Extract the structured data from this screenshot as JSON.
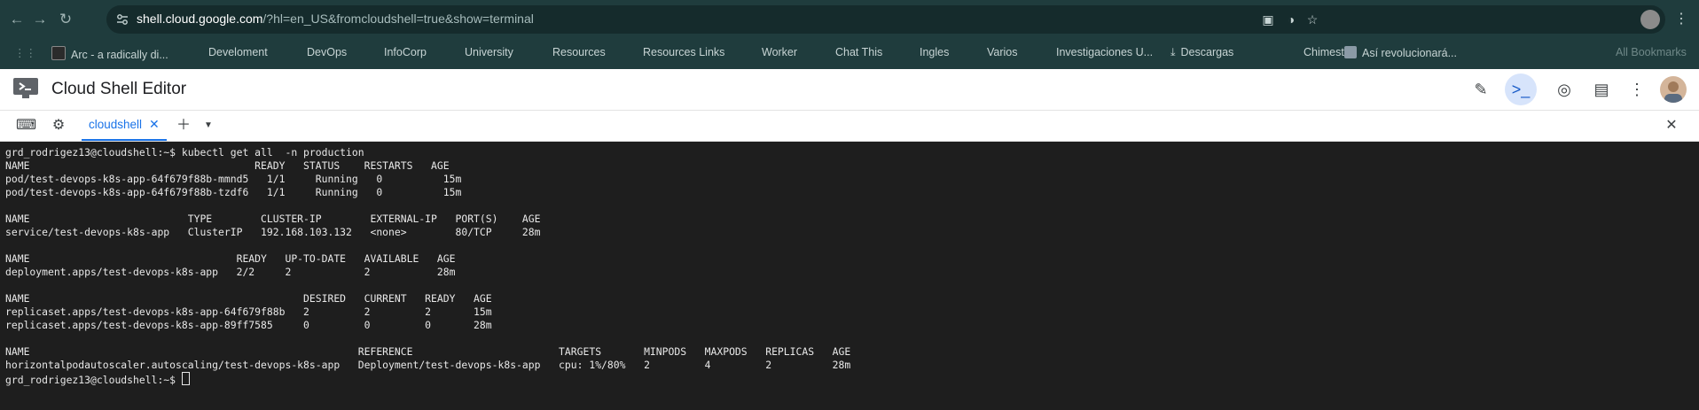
{
  "browser": {
    "url_host": "shell.cloud.google.com",
    "url_rest": "/?hl=en_US&fromcloudshell=true&show=terminal",
    "bookmarks": [
      "Arc - a radically di...",
      "Develoment",
      "DevOps",
      "InfoCorp",
      "University",
      "Resources",
      "Resources Links",
      "Worker",
      "Chat This",
      "Ingles",
      "Varios",
      "Investigaciones U...",
      "Descargas",
      "Chimestry",
      "Así revolucionará..."
    ],
    "all_bookmarks": "All Bookmarks"
  },
  "app": {
    "title": "Cloud Shell Editor"
  },
  "tabs": {
    "active_label": "cloudshell"
  },
  "terminal": {
    "lines": [
      "grd_rodrigez13@cloudshell:~$ kubectl get all  -n production",
      "NAME                                     READY   STATUS    RESTARTS   AGE",
      "pod/test-devops-k8s-app-64f679f88b-mmnd5   1/1     Running   0          15m",
      "pod/test-devops-k8s-app-64f679f88b-tzdf6   1/1     Running   0          15m",
      "",
      "NAME                          TYPE        CLUSTER-IP        EXTERNAL-IP   PORT(S)    AGE",
      "service/test-devops-k8s-app   ClusterIP   192.168.103.132   <none>        80/TCP     28m",
      "",
      "NAME                                  READY   UP-TO-DATE   AVAILABLE   AGE",
      "deployment.apps/test-devops-k8s-app   2/2     2            2           28m",
      "",
      "NAME                                             DESIRED   CURRENT   READY   AGE",
      "replicaset.apps/test-devops-k8s-app-64f679f88b   2         2         2       15m",
      "replicaset.apps/test-devops-k8s-app-89ff7585     0         0         0       28m",
      "",
      "NAME                                                      REFERENCE                        TARGETS       MINPODS   MAXPODS   REPLICAS   AGE",
      "horizontalpodautoscaler.autoscaling/test-devops-k8s-app   Deployment/test-devops-k8s-app   cpu: 1%/80%   2         4         2          28m"
    ],
    "prompt": "grd_rodrigez13@cloudshell:~$ "
  },
  "colors": {
    "chrome_bg": "#1f3c3d",
    "terminal_bg": "#1e1e1e",
    "accent": "#1a73e8"
  }
}
